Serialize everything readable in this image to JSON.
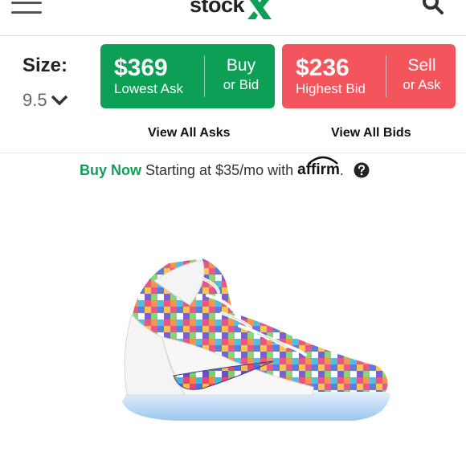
{
  "header": {
    "logo_text": "stock",
    "logo_accent": "X",
    "icons": {
      "menu": "hamburger-menu-icon",
      "search": "search-icon"
    }
  },
  "size": {
    "label": "Size:",
    "value": "9.5",
    "chevron": "chevron-down-icon"
  },
  "ask": {
    "price": "$369",
    "caption": "Lowest Ask",
    "action_top": "Buy",
    "action_bottom": "or Bid",
    "link": "View All Asks",
    "color": "#0d9f55"
  },
  "bid": {
    "price": "$236",
    "caption": "Highest Bid",
    "action_top": "Sell",
    "action_bottom": "or Ask",
    "link": "View All Bids",
    "color": "#f4545b"
  },
  "promo": {
    "buy_now": "Buy Now",
    "text": "Starting at $35/mo with",
    "brand": "affirm",
    "period": ".",
    "help_icon": "question-circle-icon"
  },
  "product": {
    "image_icon": "sneaker-product-image"
  }
}
